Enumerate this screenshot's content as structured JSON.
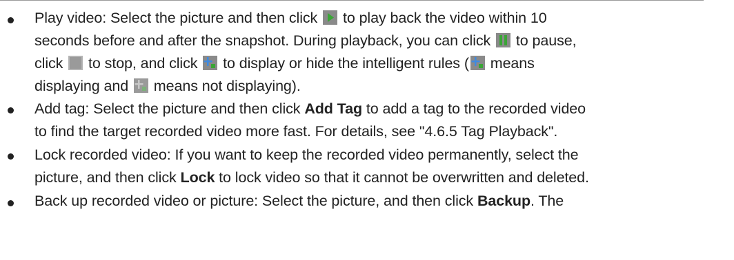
{
  "colors": {
    "text": "#222222",
    "icon_gray_bg": "#8a8a8a",
    "icon_light_bg": "#a8a8a8",
    "icon_green": "#3aa536",
    "icon_blue": "#3f8ae0",
    "icon_muted_green": "#7cb07a"
  },
  "icons": {
    "play": "play-icon",
    "pause": "pause-icon",
    "stop": "stop-icon",
    "rules_on": "intelligent-rules-icon",
    "rules_off": "intelligent-rules-off-icon"
  },
  "items": [
    {
      "lines": [
        [
          "Play video: Select the picture and then click ",
          "",
          " to play back the video within 10"
        ],
        [
          "seconds before and after the snapshot. During playback, you can click ",
          "",
          " to pause,"
        ],
        [
          "click ",
          "",
          " to stop, and click ",
          "",
          " to display or hide the intelligent rules (",
          "",
          " means"
        ],
        [
          "displaying and ",
          "",
          " means not displaying)."
        ]
      ]
    },
    {
      "lines": [
        [
          "Add tag: Select the picture and then click ",
          "Add Tag",
          " to add a tag to the recorded video"
        ],
        [
          "to find the target recorded video more fast. For details, see \"4.6.5 Tag Playback\"."
        ]
      ]
    },
    {
      "lines": [
        [
          "Lock recorded video: If you want to keep the recorded video permanently, select the"
        ],
        [
          "picture, and then click ",
          "Lock",
          " to lock video so that it cannot be overwritten and deleted."
        ]
      ]
    },
    {
      "lines": [
        [
          "Back up recorded video or picture: Select the picture, and then click ",
          "Backup",
          ". The"
        ]
      ]
    }
  ]
}
